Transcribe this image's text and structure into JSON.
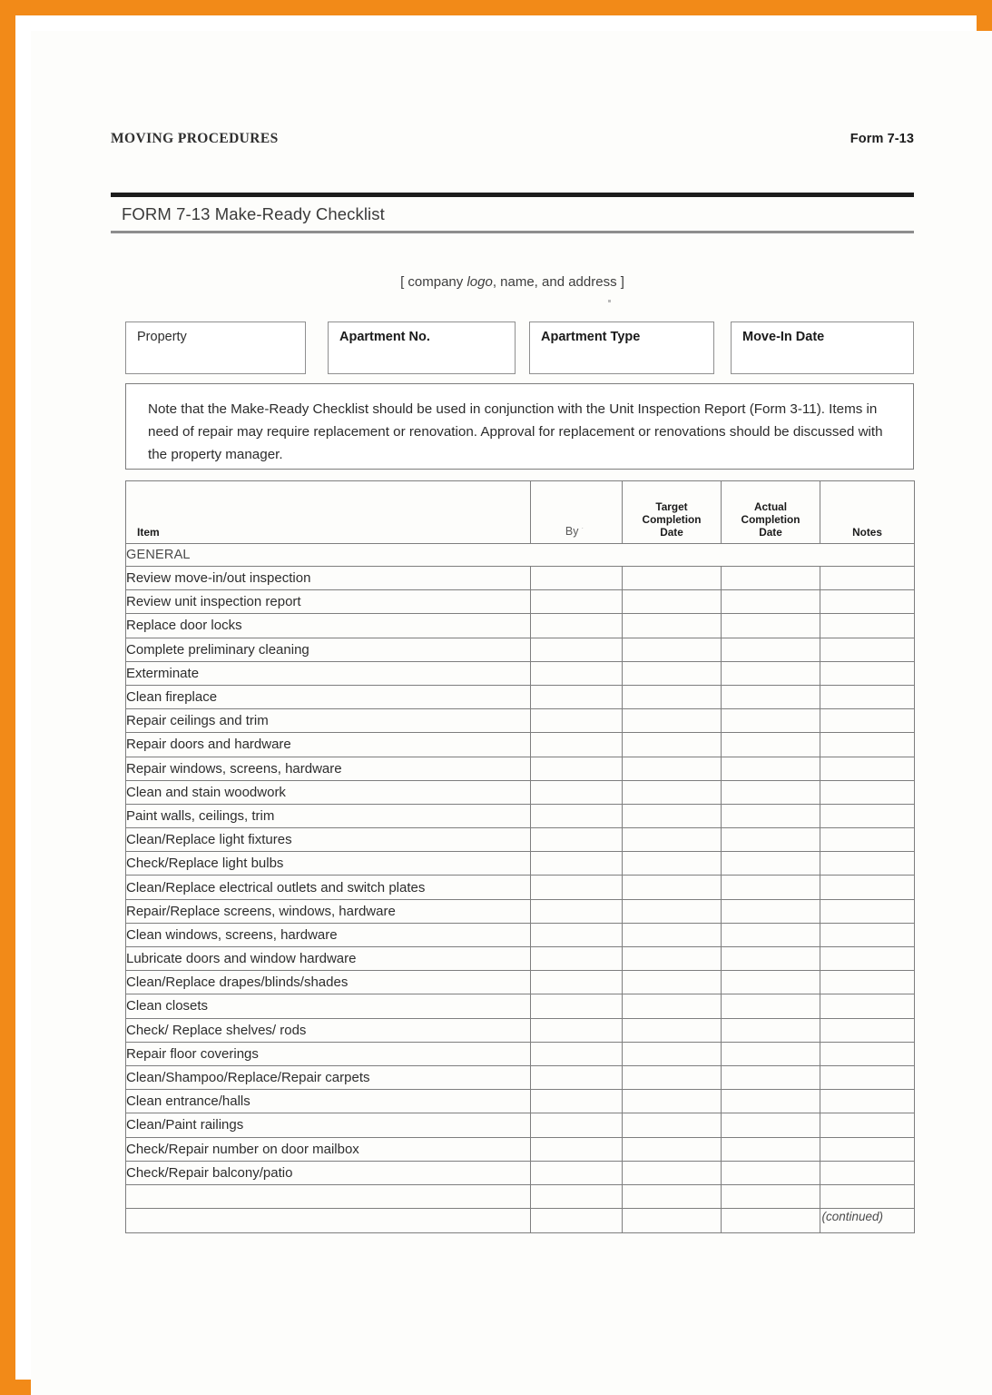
{
  "page": {
    "frame_color": "#f28a18",
    "running_head_left": "MOVING PROCEDURES",
    "running_head_right": "Form 7-13",
    "title": "FORM 7-13 Make-Ready Checklist",
    "continued_label": "(continued)"
  },
  "company_line": {
    "prefix": "[ company ",
    "italic": "logo",
    "suffix": ", name, and address ]"
  },
  "fields": [
    {
      "label": "Property",
      "bold": false
    },
    {
      "label": "Apartment No.",
      "bold": true
    },
    {
      "label": "Apartment Type",
      "bold": true
    },
    {
      "label": "Move-In Date",
      "bold": true
    }
  ],
  "note": {
    "text": "Note that the Make-Ready Checklist should be used in conjunction with the Unit Inspection Report (Form 3-11). Items in need of repair may require replacement or renovation. Approval for replacement or renovations should be discussed with the property manager."
  },
  "table": {
    "headers": {
      "item": "Item",
      "by": "By",
      "target": "Target\nCompletion\nDate",
      "target_line1": "Target",
      "target_line2": "Completion",
      "target_line3": "Date",
      "actual_line1": "Actual",
      "actual_line2": "Completion",
      "actual_line3": "Date",
      "notes": "Notes"
    },
    "section": "GENERAL",
    "rows": [
      "Review move-in/out inspection",
      "Review unit inspection report",
      "Replace door locks",
      "Complete preliminary cleaning",
      "Exterminate",
      "Clean fireplace",
      "Repair ceilings and trim",
      "Repair doors and hardware",
      "Repair windows, screens, hardware",
      "Clean and stain woodwork",
      "Paint walls, ceilings, trim",
      "Clean/Replace light fixtures",
      "Check/Replace light bulbs",
      "Clean/Replace electrical outlets and switch plates",
      "Repair/Replace screens, windows, hardware",
      "Clean windows, screens, hardware",
      "Lubricate doors and window hardware",
      "Clean/Replace drapes/blinds/shades",
      "Clean closets",
      "Check/ Replace shelves/ rods",
      "Repair floor coverings",
      "Clean/Shampoo/Replace/Repair carpets",
      "Clean entrance/halls",
      "Clean/Paint railings",
      "Check/Repair number on door mailbox",
      "Check/Repair balcony/patio"
    ],
    "blank_rows": 2
  }
}
